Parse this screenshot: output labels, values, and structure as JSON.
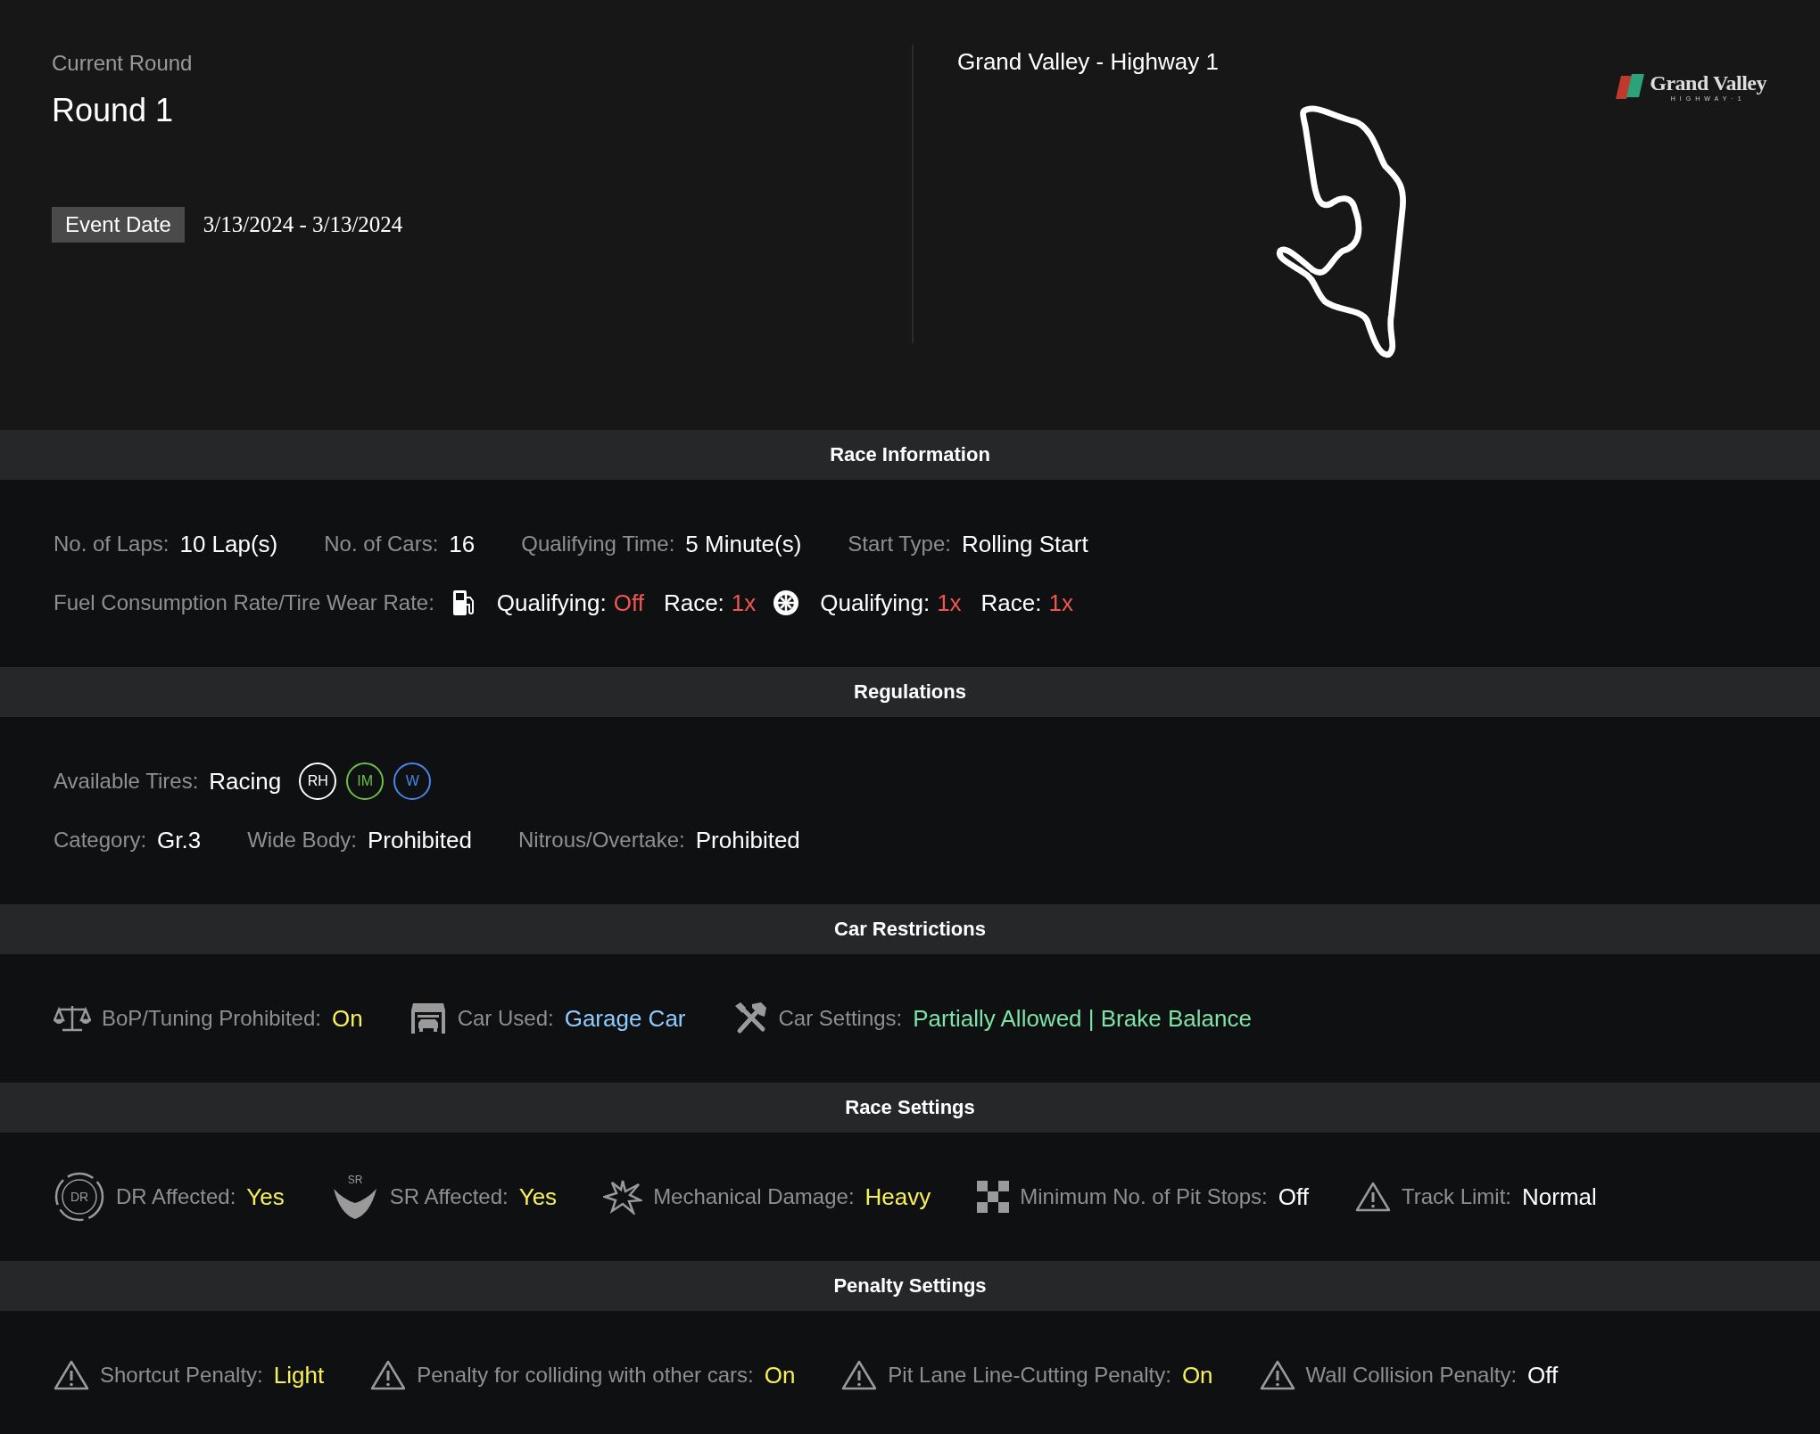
{
  "round": {
    "subtitle": "Current Round",
    "title": "Round 1",
    "event_date_label": "Event Date",
    "event_date": "3/13/2024 - 3/13/2024"
  },
  "track": {
    "name": "Grand Valley - Highway 1",
    "logo_title": "Grand Valley",
    "logo_subtitle": "HIGHWAY·1"
  },
  "sections": [
    {
      "title": "Race Information",
      "lines": [
        {
          "items": [
            {
              "kind": "pair",
              "label": "No. of Laps:",
              "value": "10 Lap(s)",
              "color": "#ffffff"
            },
            {
              "kind": "pair",
              "label": "No. of Cars:",
              "value": "16",
              "color": "#ffffff"
            },
            {
              "kind": "pair",
              "label": "Qualifying Time:",
              "value": "5 Minute(s)",
              "color": "#ffffff"
            },
            {
              "kind": "pair",
              "label": "Start Type:",
              "value": "Rolling Start",
              "color": "#ffffff"
            }
          ]
        },
        {
          "items": [
            {
              "kind": "label",
              "label": "Fuel Consumption Rate/Tire Wear Rate:"
            },
            {
              "kind": "rates",
              "parts": [
                {
                  "label": "Qualifying:",
                  "value": "Off",
                  "color": "#f0564f"
                },
                {
                  "label": "Race:",
                  "value": "1x",
                  "color": "#f0564f"
                }
              ]
            },
            {
              "kind": "rates",
              "parts": [
                {
                  "label": "Qualifying:",
                  "value": "1x",
                  "color": "#f0564f"
                },
                {
                  "label": "Race:",
                  "value": "1x",
                  "color": "#f0564f"
                }
              ]
            }
          ]
        }
      ]
    },
    {
      "title": "Regulations",
      "lines": [
        {
          "items": [
            {
              "kind": "tires",
              "label": "Available Tires:",
              "value": "Racing",
              "color": "#ffffff",
              "tires": [
                {
                  "code": "RH",
                  "color": "#ffffff"
                },
                {
                  "code": "IM",
                  "color": "#6cc04a"
                },
                {
                  "code": "W",
                  "color": "#4a86e8"
                }
              ]
            }
          ]
        },
        {
          "items": [
            {
              "kind": "pair",
              "label": "Category:",
              "value": "Gr.3",
              "color": "#ffffff"
            },
            {
              "kind": "pair",
              "label": "Wide Body:",
              "value": "Prohibited",
              "color": "#ffffff"
            },
            {
              "kind": "pair",
              "label": "Nitrous/Overtake:",
              "value": "Prohibited",
              "color": "#ffffff"
            }
          ]
        }
      ]
    },
    {
      "title": "Car Restrictions",
      "lines": [
        {
          "items": [
            {
              "kind": "pair",
              "label": "BoP/Tuning Prohibited:",
              "value": "On",
              "color": "#f7f156"
            },
            {
              "kind": "pair",
              "label": "Car Used:",
              "value": "Garage Car",
              "color": "#8ecbff"
            },
            {
              "kind": "pair",
              "label": "Car Settings:",
              "value": "Partially Allowed | Brake Balance",
              "color": "#7ee3a6"
            }
          ]
        }
      ]
    },
    {
      "title": "Race Settings",
      "lines": [
        {
          "items": [
            {
              "kind": "pair",
              "badge_text": "DR",
              "label": "DR Affected:",
              "value": "Yes",
              "color": "#f7f156"
            },
            {
              "kind": "pair",
              "badge_text": "SR",
              "label": "SR Affected:",
              "value": "Yes",
              "color": "#f7f156"
            },
            {
              "kind": "pair",
              "label": "Mechanical Damage:",
              "value": "Heavy",
              "color": "#f7f156"
            },
            {
              "kind": "pair",
              "label": "Minimum No. of Pit Stops:",
              "value": "Off",
              "color": "#ffffff"
            },
            {
              "kind": "pair",
              "label": "Track Limit:",
              "value": "Normal",
              "color": "#ffffff"
            }
          ]
        }
      ]
    },
    {
      "title": "Penalty Settings",
      "lines": [
        {
          "items": [
            {
              "kind": "pair",
              "label": "Shortcut Penalty:",
              "value": "Light",
              "color": "#f7f156"
            },
            {
              "kind": "pair",
              "label": "Penalty for colliding with other cars:",
              "value": "On",
              "color": "#f7f156"
            },
            {
              "kind": "pair",
              "label": "Pit Lane Line-Cutting Penalty:",
              "value": "On",
              "color": "#f7f156"
            },
            {
              "kind": "pair",
              "label": "Wall Collision Penalty:",
              "value": "Off",
              "color": "#ffffff"
            }
          ]
        }
      ]
    }
  ]
}
